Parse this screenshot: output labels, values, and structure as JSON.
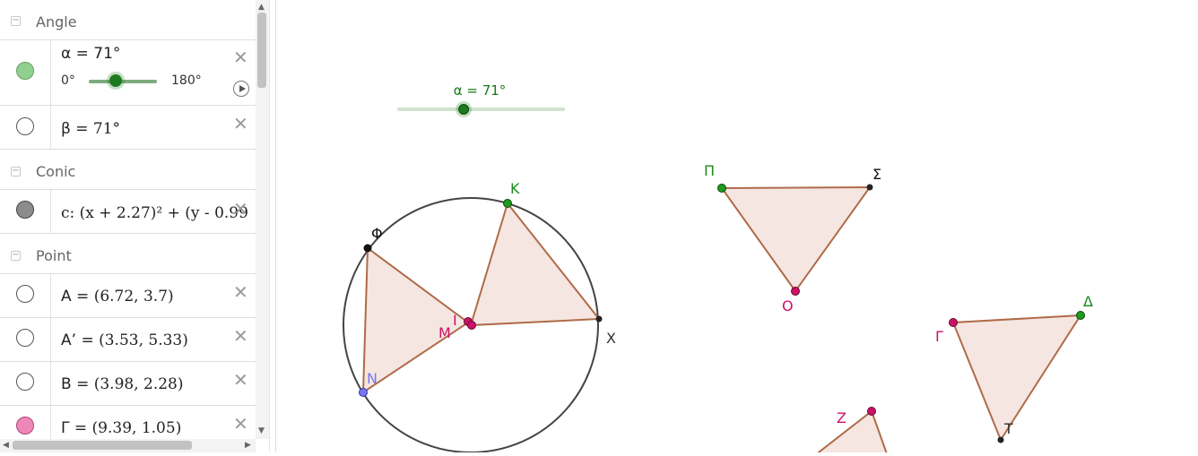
{
  "algebra": {
    "groups": [
      {
        "title": "Angle"
      },
      {
        "title": "Conic"
      },
      {
        "title": "Point"
      }
    ],
    "rows": [
      {
        "name": "α",
        "value": "71°",
        "marble_color": "#8fcf8f",
        "min": "0°",
        "max": "180°",
        "slider_fraction": 0.394
      },
      {
        "name": "β",
        "value": "71°",
        "marble_color": "#ffffff"
      },
      {
        "name": "c: ",
        "value": "(x + 2.27)² + (y - 0.99",
        "marble_color": "#8c8c8c"
      },
      {
        "name": "A",
        "value": "(6.72, 3.7)",
        "marble_color": "#ffffff"
      },
      {
        "name": "A’",
        "value": "(3.53, 5.33)",
        "marble_color": "#ffffff"
      },
      {
        "name": "B",
        "value": "(3.98, 2.28)",
        "marble_color": "#ffffff"
      },
      {
        "name": "Γ",
        "value": "(9.39, 1.05)",
        "marble_color": "#ee88b8"
      }
    ],
    "eq": " = ",
    "delete_glyph": "✕",
    "collapse_glyph": "−"
  },
  "graphics": {
    "slider": {
      "label": "α = 71°",
      "fraction": 0.394
    },
    "labels": {
      "K": "K",
      "Phi": "Φ",
      "I": "I",
      "M": "M",
      "N": "N",
      "X": "X",
      "Pi": "Π",
      "Sigma": "Σ",
      "O": "O",
      "Gamma": "Γ",
      "Delta": "Δ",
      "T": "T",
      "Z": "Z"
    },
    "colors": {
      "fill": "#f5e6e2",
      "edge": "#b06b48",
      "circle": "#444444",
      "green_point": "#1f9a1f",
      "magenta_point": "#cc1166",
      "black_point": "#222222",
      "blue_point": "#7777ee"
    }
  }
}
